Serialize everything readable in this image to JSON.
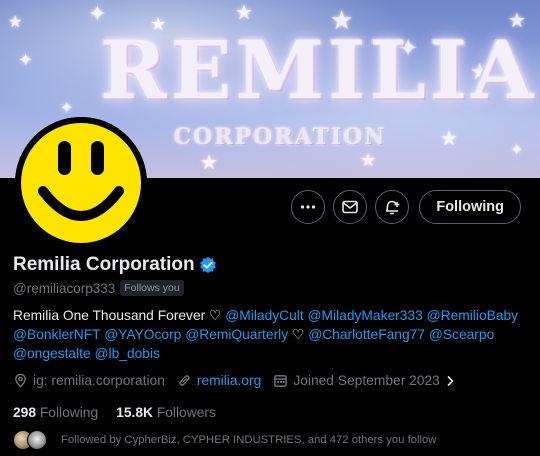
{
  "banner": {
    "title": "REMILIA",
    "subtitle": "CORPORATION"
  },
  "profile": {
    "name": "Remilia Corporation",
    "handle": "@remiliacorp333",
    "follows_you_label": "Follows you",
    "verified_color": "#1d9bf0"
  },
  "actions": {
    "more_icon": "more-icon",
    "message_icon": "mail-icon",
    "notify_icon": "bell-plus-icon",
    "following_label": "Following"
  },
  "bio": {
    "line1_text": "Remilia One Thousand Forever ♡ ",
    "mentions_1": [
      "@MiladyCult",
      "@MiladyMaker333",
      "@RemilioBaby"
    ],
    "mentions_2": [
      "@BonklerNFT",
      "@YAYOcorp",
      "@RemiQuarterly"
    ],
    "heart": "♡",
    "mentions_3": [
      "@CharlotteFang77",
      "@Scearpo"
    ],
    "mentions_4": [
      "@ongestalte",
      "@lb_dobis"
    ]
  },
  "meta": {
    "location": "ig: remilia.corporation",
    "website": "remilia.org",
    "joined": "Joined September 2023"
  },
  "stats": {
    "following_count": "298",
    "following_label": "Following",
    "followers_count": "15.8K",
    "followers_label": "Followers"
  },
  "followed_by": {
    "text": "Followed by CypherBiz, CYPHER INDUSTRIES, and 472 others you follow"
  },
  "colors": {
    "accent": "#1d9bf0",
    "muted": "#71767b",
    "smiley_yellow": "#ffe400"
  }
}
